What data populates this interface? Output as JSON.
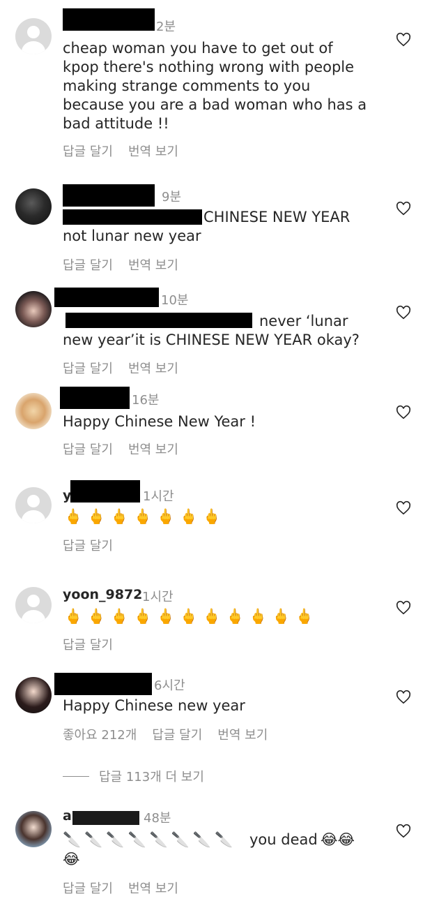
{
  "comments": [
    {
      "time": "2분",
      "lines": [
        "cheap woman you have to get out of",
        "kpop there's nothing wrong with people",
        "making strange comments to you",
        "because you are a bad woman who has a",
        "bad attitude !!"
      ],
      "reply": "답글 달기",
      "translate": "번역 보기"
    },
    {
      "time": "9분",
      "line1_visible": "CHINESE NEW YEAR",
      "line2": "not lunar new year",
      "reply": "답글 달기",
      "translate": "번역 보기"
    },
    {
      "time": "10분",
      "line1_visible": "never ‘lunar",
      "line2": "new year’it is CHINESE NEW YEAR okay?",
      "reply": "답글 달기",
      "translate": "번역 보기"
    },
    {
      "time": "16분",
      "text": "Happy Chinese New Year !",
      "reply": "답글 달기",
      "translate": "번역 보기"
    },
    {
      "username_visible": "y",
      "time": "1시간",
      "emoji": "🖕🖕🖕🖕🖕🖕🖕",
      "reply": "답글 달기"
    },
    {
      "username": "yoon_9872",
      "time": "1시간",
      "emoji": "🖕🖕🖕🖕🖕🖕🖕🖕🖕🖕🖕",
      "reply": "답글 달기"
    },
    {
      "time": "6시간",
      "text": "Happy Chinese new year",
      "likes": "좋아요 212개",
      "reply": "답글 달기",
      "translate": "번역 보기"
    },
    {
      "username_visible": "a",
      "time": "48분",
      "knives": "🔪🔪🔪🔪🔪🔪🔪🔪",
      "text": "you dead",
      "emoji": "😂😂",
      "emoji2": "😂",
      "reply": "답글 달기",
      "translate": "번역 보기"
    }
  ],
  "view_more_replies": "답글 113개 더 보기",
  "icons": {
    "heart": "heart-outline-icon",
    "avatar_default": "default-avatar-icon"
  },
  "colors": {
    "text": "#262626",
    "secondary": "#8e8e8e",
    "avatar_bg": "#dbdbdb"
  }
}
